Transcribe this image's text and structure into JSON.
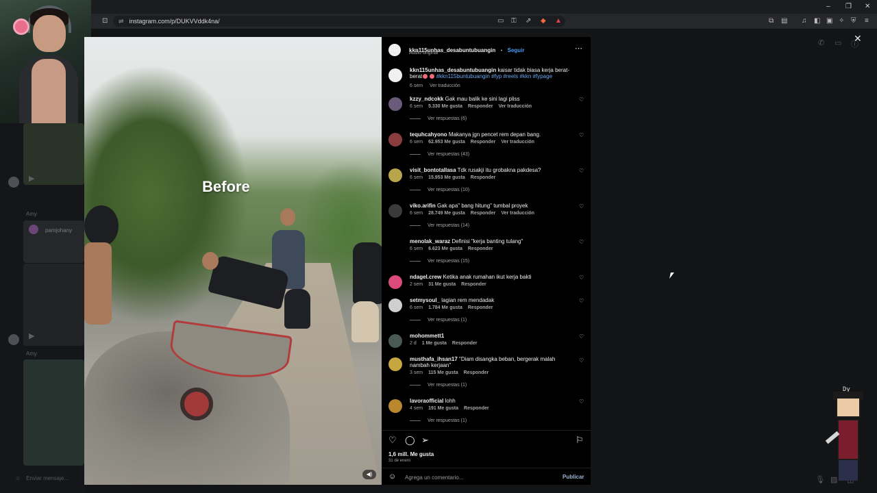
{
  "browser": {
    "url": "instagram.com/p/DUKVVddk4na/",
    "window_controls": [
      "–",
      "❐",
      "✕"
    ]
  },
  "left_panel": {
    "username": "pamjohany",
    "labels": [
      "Amy",
      "Amy"
    ],
    "message_placeholder": "Enviar mensaje..."
  },
  "video": {
    "overlay_text": "Before"
  },
  "post": {
    "author": "kkn115unhas_desabuntubuangin",
    "separator": "•",
    "follow_label": "Seguir",
    "audio": "Audio original",
    "more_icon": "more-horizontal-icon",
    "caption": {
      "username": "kkn115unhas_desabuntubuangin",
      "text": "kaisar tidak biasa kerja berat-berat",
      "hashtags": "#kkn115buntubuangin #fyp #reels #kkn #fypage",
      "time": "6 sem",
      "translate": "Ver traducción"
    },
    "comments": [
      {
        "username": "kzzy_ndcokk",
        "text": "Gak mau balik ke sini lagi pliss",
        "time": "6 sem",
        "likes": "5.330 Me gusta",
        "reply": "Responder",
        "translate": "Ver traducción",
        "replies": "Ver respuestas (6)"
      },
      {
        "username": "tequhcahyono",
        "text": "Makanya jgn pencet rem depan bang.",
        "time": "6 sem",
        "likes": "62.953 Me gusta",
        "reply": "Responder",
        "translate": "Ver traducción",
        "replies": "Ver respuestas (43)"
      },
      {
        "username": "visit_bontotallasa",
        "text": "Tdk rusakji itu grobakna pakdesa?",
        "time": "6 sem",
        "likes": "15.953 Me gusta",
        "reply": "Responder",
        "translate": "",
        "replies": "Ver respuestas (10)"
      },
      {
        "username": "viko.arifin",
        "text": "Gak apa\" bang hitung\" tumbal proyek",
        "time": "6 sem",
        "likes": "28.749 Me gusta",
        "reply": "Responder",
        "translate": "Ver traducción",
        "replies": "Ver respuestas (14)"
      },
      {
        "username": "menolak_waraz",
        "text": "Definisi \"kerja banting tulang\"",
        "time": "6 sem",
        "likes": "6.623 Me gusta",
        "reply": "Responder",
        "translate": "",
        "replies": "Ver respuestas (15)"
      },
      {
        "username": "ndagel.crew",
        "text": "Ketika anak rumahan ikut kerja bakti",
        "time": "2 sem",
        "likes": "31 Me gusta",
        "reply": "Responder",
        "translate": "",
        "replies": ""
      },
      {
        "username": "setmysoul_",
        "text": "lagian rem mendadak",
        "time": "6 sem",
        "likes": "1.784 Me gusta",
        "reply": "Responder",
        "translate": "",
        "replies": "Ver respuestas (1)"
      },
      {
        "username": "mohommett1",
        "text": "",
        "time": "2 d",
        "likes": "1 Me gusta",
        "reply": "Responder",
        "translate": "",
        "replies": ""
      },
      {
        "username": "musthafa_ihsan17",
        "text": "\"Diam disangka beban, bergerak malah nambah kerjaan\"",
        "time": "3 sem",
        "likes": "115 Me gusta",
        "reply": "Responder",
        "translate": "",
        "replies": "Ver respuestas (1)"
      },
      {
        "username": "lavoraofficial",
        "text": "lohh",
        "time": "4 sem",
        "likes": "191 Me gusta",
        "reply": "Responder",
        "translate": "",
        "replies": "Ver respuestas (1)"
      }
    ],
    "likes_total": "1,6 mill. Me gusta",
    "date": "31 de enero",
    "comment_placeholder": "Agrega un comentario...",
    "publish_label": "Publicar"
  },
  "mascot_tag": "Dy",
  "colors": {
    "accent": "#4a9cf5",
    "background": "#000000"
  }
}
